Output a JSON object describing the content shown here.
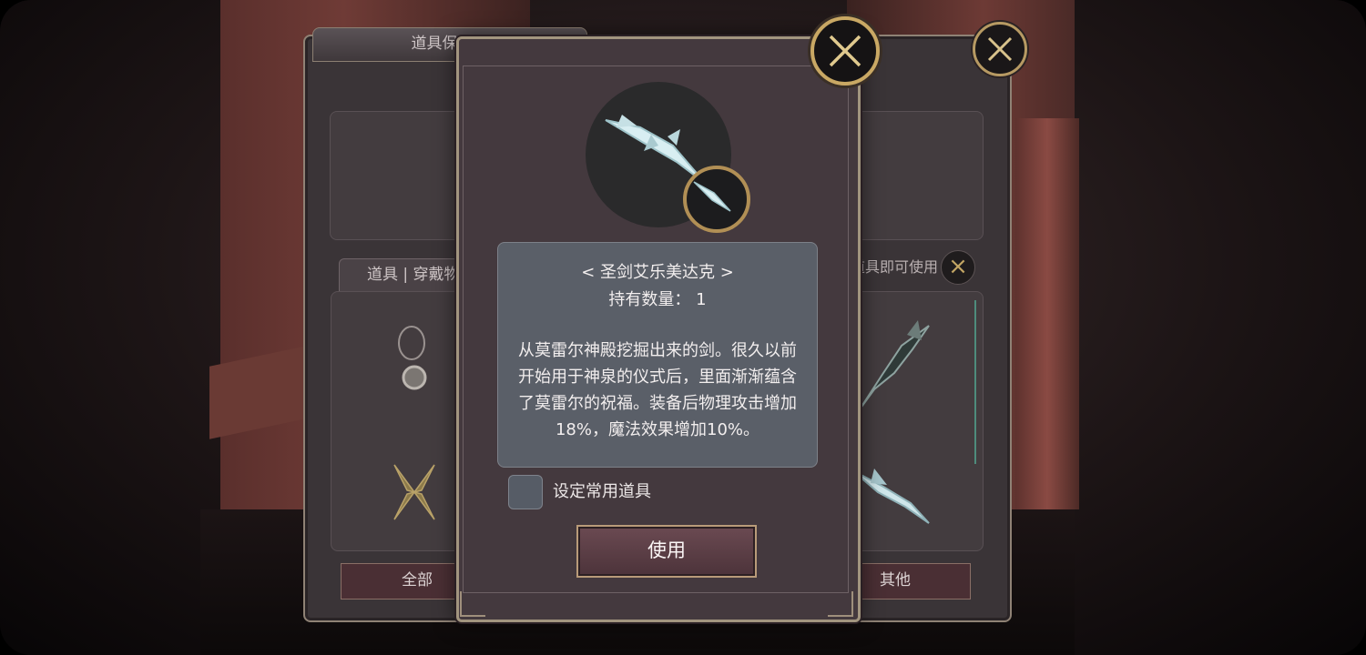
{
  "background_panel": {
    "title": "道具保管箱",
    "tab_label": "道具 | 穿戴物品",
    "hint": "击道具即可使用",
    "filters": {
      "all": "全部",
      "other": "其他"
    }
  },
  "item_detail": {
    "name": "< 圣剑艾乐美达克 >",
    "quantity": "持有数量： 1",
    "description": "从莫雷尔神殿挖掘出来的剑。很久以前开始用于神泉的仪式后，里面渐渐蕴含了莫雷尔的祝福。装备后物理攻击增加18%，魔法效果增加10%。",
    "favorite_label": "设定常用道具",
    "use_label": "使用"
  },
  "icons": {
    "close": "close-icon",
    "item": "holy-sword-icon"
  },
  "colors": {
    "gold_frame": "#c9a864",
    "use_button": "#5b3e45",
    "desc_panel": "#5a5f68"
  }
}
